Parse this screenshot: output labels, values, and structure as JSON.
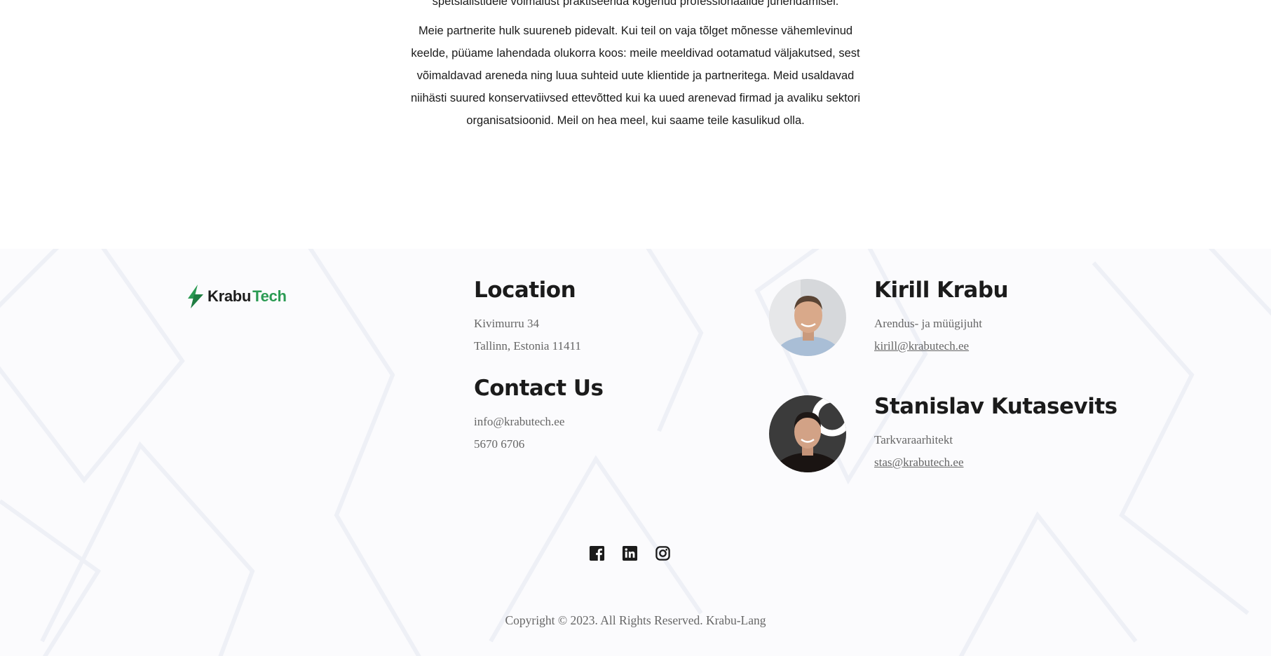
{
  "intro": {
    "partial_line": "spetsialistidele võimalust praktiseerida kogenud professionaalide juhendamisel.",
    "paragraph": "Meie partnerite hulk suureneb pidevalt. Kui teil on vaja tõlget mõnesse vähemlevinud keelde, püüame lahendada olukorra koos: meile meeldivad ootamatud väljakutsed, sest võimaldavad areneda ning luua suhteid uute klientide ja partneritega. Meid usaldavad niihästi suured konservatiivsed ettevõtted kui ka uued arenevad firmad ja avaliku sektori organisatsioonid. Meil on hea meel, kui saame teile kasulikud olla."
  },
  "footer": {
    "logo": {
      "part1": "Krabu",
      "part2": "Tech",
      "icon": "leaf-logo-icon"
    },
    "location": {
      "heading": "Location",
      "line1": "Kivimurru 34",
      "line2": "Tallinn, Estonia 11411"
    },
    "contact": {
      "heading": "Contact Us",
      "email": "info@krabutech.ee",
      "phone": "5670 6706"
    },
    "people": [
      {
        "name": "Kirill Krabu",
        "role": "Arendus- ja müügijuht",
        "email": "kirill@krabutech.ee"
      },
      {
        "name": "Stanislav Kutasevits",
        "role": "Tarkvaraarhitekt",
        "email": "stas@krabutech.ee"
      }
    ],
    "social": [
      "facebook-icon",
      "linkedin-icon",
      "instagram-icon"
    ],
    "copyright": "Copyright ©  2023. All Rights Reserved. Krabu-Lang"
  },
  "colors": {
    "brand_green": "#2b9b53",
    "heading": "#1b1b1b",
    "muted": "#666666",
    "footer_bg": "#fbfbfd"
  }
}
